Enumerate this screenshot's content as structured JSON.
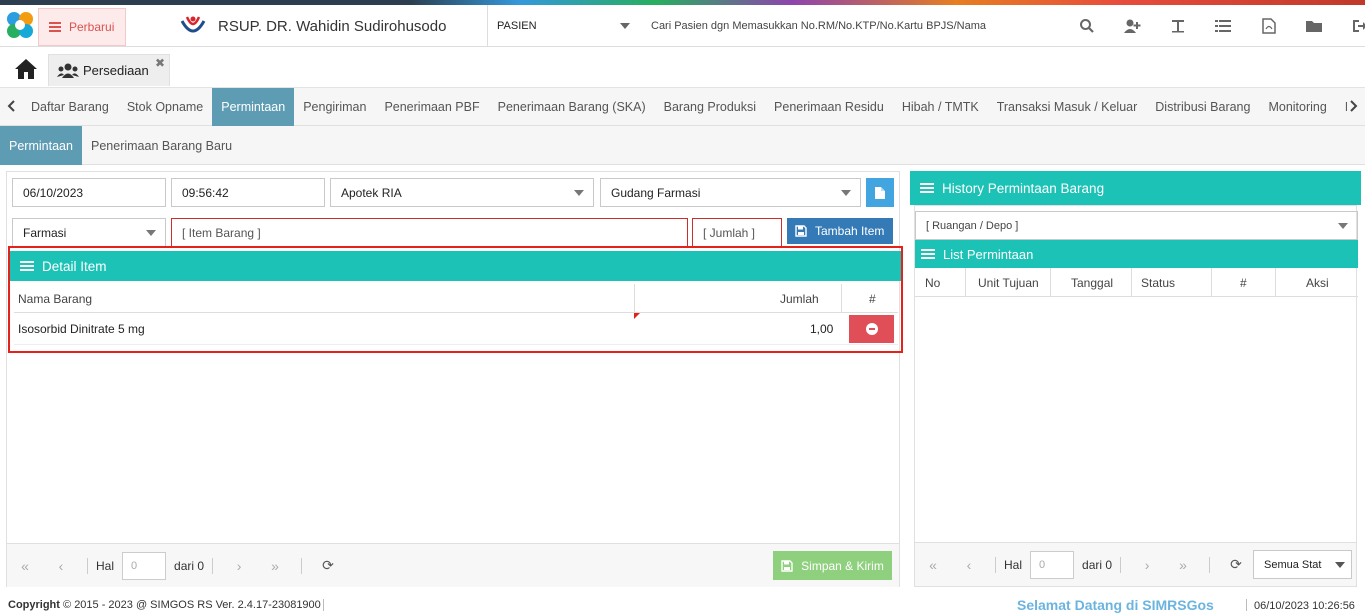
{
  "header": {
    "refresh_label": "Perbarui",
    "hospital_name": "RSUP. DR. Wahidin Sudirohusodo",
    "patient_select": "PASIEN",
    "search_placeholder": "Cari Pasien dgn Memasukkan No.RM/No.KTP/No.Kartu BPJS/Nama",
    "icons": [
      "search-icon",
      "add-user-icon",
      "text-icon",
      "list-icon",
      "pdf-icon",
      "folder-icon",
      "logout-icon"
    ]
  },
  "module_tab": {
    "label": "Persediaan"
  },
  "menu_tabs": [
    {
      "label": "Daftar Barang"
    },
    {
      "label": "Stok Opname"
    },
    {
      "label": "Permintaan"
    },
    {
      "label": "Pengiriman"
    },
    {
      "label": "Penerimaan PBF"
    },
    {
      "label": "Penerimaan Barang (SKA)"
    },
    {
      "label": "Barang Produksi"
    },
    {
      "label": "Penerimaan Residu"
    },
    {
      "label": "Hibah / TMTK"
    },
    {
      "label": "Transaksi Masuk / Keluar"
    },
    {
      "label": "Distribusi Barang"
    },
    {
      "label": "Monitoring"
    },
    {
      "label": "Moni"
    }
  ],
  "active_menu": "Permintaan",
  "sub_tabs": [
    {
      "label": "Permintaan"
    },
    {
      "label": "Penerimaan Barang Baru"
    }
  ],
  "form": {
    "date": "06/10/2023",
    "time": "09:56:42",
    "from_unit": "Apotek RIA",
    "to_unit": "Gudang Farmasi",
    "category": "Farmasi",
    "item_placeholder": "[ Item Barang ]",
    "qty_placeholder": "[ Jumlah ]",
    "add_button": "Tambah Item"
  },
  "detail": {
    "title": "Detail Item",
    "columns": [
      "Nama Barang",
      "Jumlah",
      "#"
    ],
    "rows": [
      {
        "name": "Isosorbid Dinitrate 5 mg",
        "qty": "1,00"
      }
    ]
  },
  "pager_left": {
    "page_label": "Hal",
    "page_value": "0",
    "of_label": "dari 0",
    "save_button": "Simpan & Kirim"
  },
  "history": {
    "title": "History Permintaan Barang",
    "room_placeholder": "[ Ruangan / Depo ]",
    "list_title": "List Permintaan",
    "columns": [
      "No",
      "Unit Tujuan",
      "Tanggal",
      "Status",
      "#",
      "Aksi"
    ],
    "page_label": "Hal",
    "page_value": "0",
    "of_label": "dari 0",
    "status_filter": "Semua Stat"
  },
  "footer": {
    "copyright_label": "Copyright",
    "copyright_text": "2015 - 2023 @ SIMGOS RS Ver. 2.4.17-23081900",
    "welcome": "Selamat Datang di SIMRSGos",
    "datetime": "06/10/2023 10:26:56"
  },
  "colors": {
    "accent_teal": "#1cc2b6",
    "tab_active": "#5e9cb4",
    "primary_button": "#337ab7",
    "danger_button": "#e04e58",
    "save_button": "#8fd07e",
    "highlight_box": "#e5211c"
  }
}
